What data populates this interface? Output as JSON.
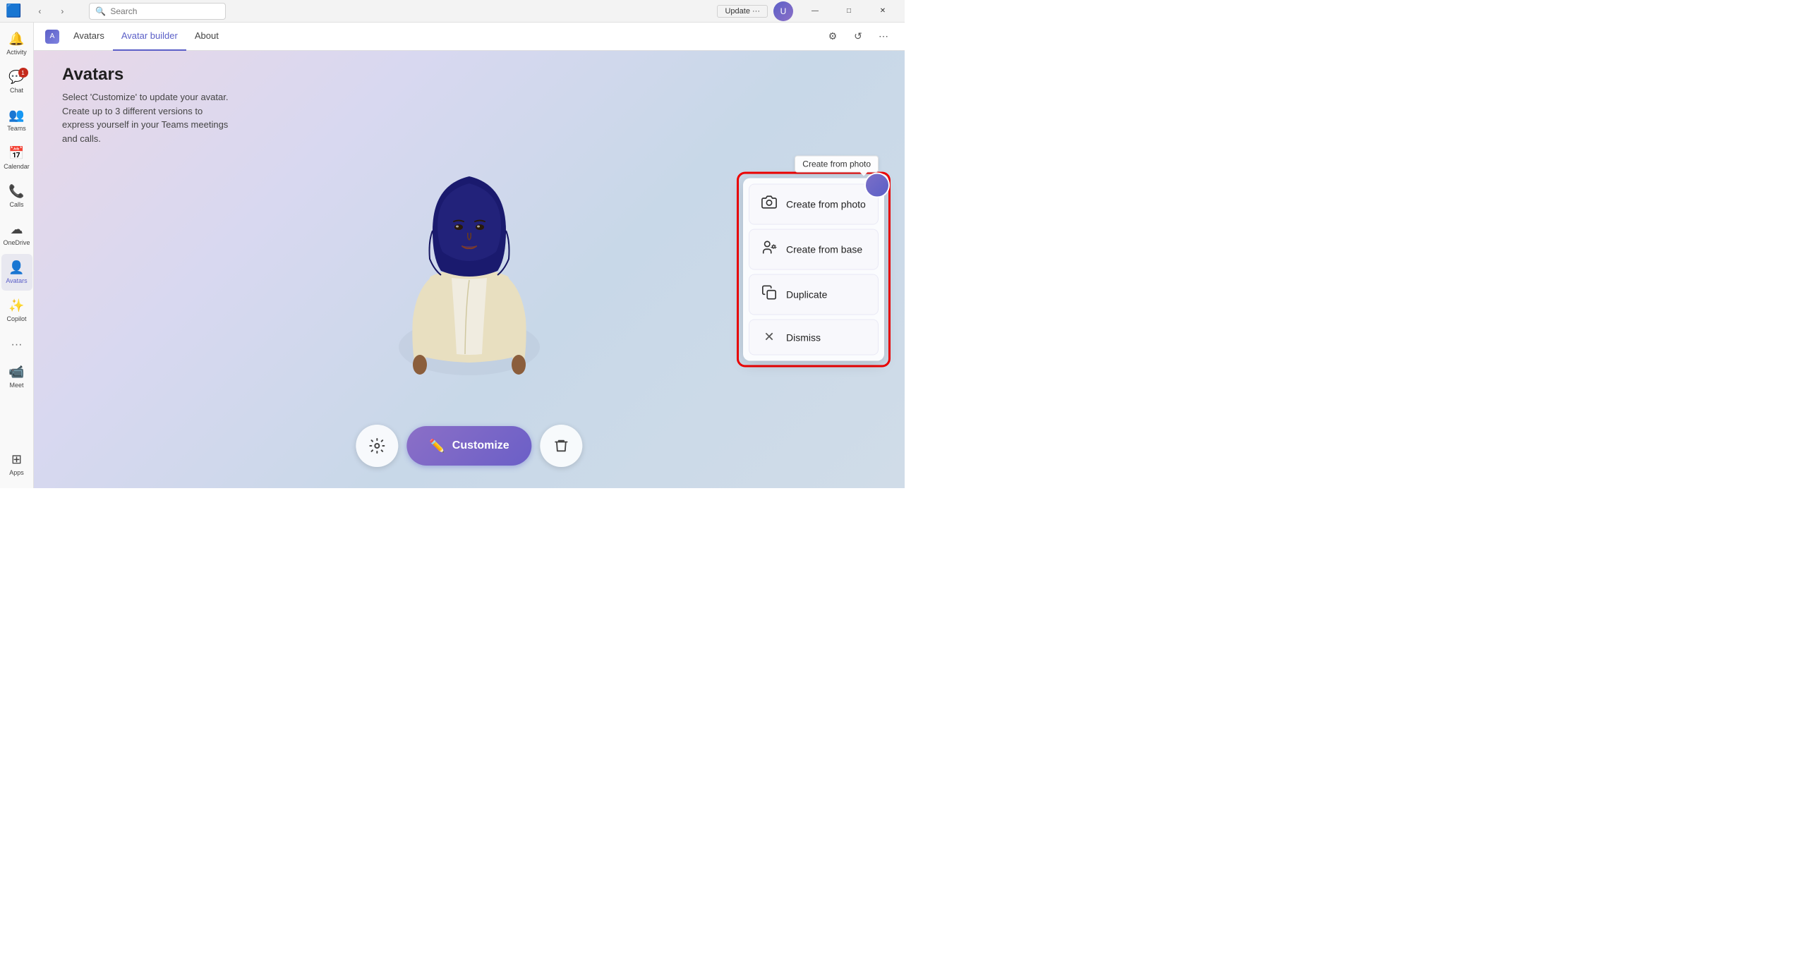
{
  "window": {
    "title": "Microsoft Teams",
    "update_btn": "Update ···"
  },
  "search": {
    "placeholder": "Search"
  },
  "tabs": {
    "app_name": "Avatars",
    "items": [
      {
        "label": "Avatars",
        "active": false
      },
      {
        "label": "Avatar builder",
        "active": true
      },
      {
        "label": "About",
        "active": false
      }
    ]
  },
  "sidebar": {
    "items": [
      {
        "label": "Activity",
        "icon": "🔔",
        "badge": null
      },
      {
        "label": "Chat",
        "icon": "💬",
        "badge": "1"
      },
      {
        "label": "Teams",
        "icon": "👥",
        "badge": null
      },
      {
        "label": "Calendar",
        "icon": "📅",
        "badge": null
      },
      {
        "label": "Calls",
        "icon": "📞",
        "badge": null
      },
      {
        "label": "OneDrive",
        "icon": "☁",
        "badge": null
      },
      {
        "label": "Avatars",
        "icon": "👤",
        "badge": null,
        "active": true
      },
      {
        "label": "Copilot",
        "icon": "✨",
        "badge": null
      },
      {
        "label": "Meet",
        "icon": "📹",
        "badge": null
      },
      {
        "label": "Apps",
        "icon": "⊞",
        "badge": null
      }
    ]
  },
  "page": {
    "title": "Avatars",
    "description": "Select 'Customize' to update your avatar. Create up to 3 different versions to express yourself in your Teams meetings and calls."
  },
  "toolbar": {
    "settings_btn": "⚙",
    "customize_label": "Customize",
    "delete_btn": "🗑"
  },
  "popup": {
    "tooltip": "Create from photo",
    "menu_items": [
      {
        "icon": "📷",
        "label": "Create from photo"
      },
      {
        "icon": "👤",
        "label": "Create from base"
      },
      {
        "icon": "📋",
        "label": "Duplicate"
      },
      {
        "icon": "",
        "label": "Dismiss"
      }
    ]
  }
}
